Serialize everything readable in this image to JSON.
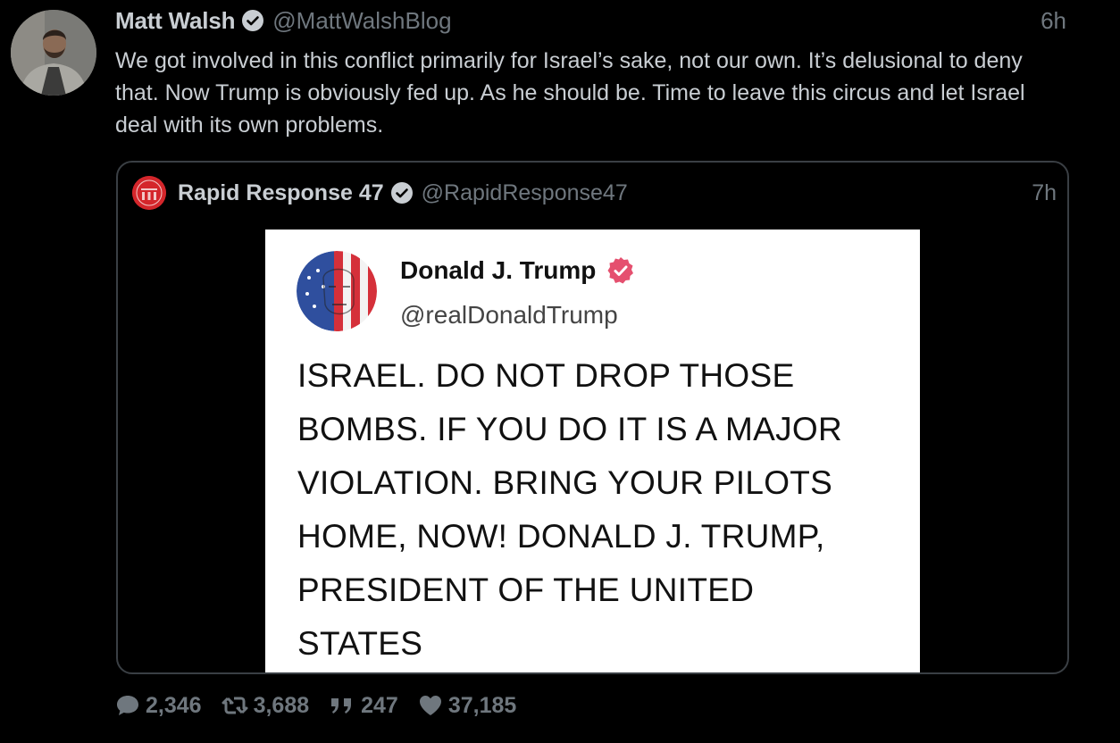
{
  "author": {
    "display_name": "Matt Walsh",
    "handle": "@MattWalshBlog",
    "timestamp": "6h",
    "avatar_icon": "profile-photo-man-beard"
  },
  "tweet": {
    "text": "We got involved in this conflict primarily for Israel’s sake, not our own. It’s delusional to deny that. Now Trump is obviously fed up. As he should be. Time to leave this circus and let Israel deal with its own problems."
  },
  "quote": {
    "display_name": "Rapid Response 47",
    "handle": "@RapidResponse47",
    "timestamp": "7h",
    "avatar_icon": "rapid-response-seal",
    "embed": {
      "name": "Donald J. Trump",
      "handle": "@realDonaldTrump",
      "avatar_icon": "flag-face-portrait",
      "badge_color": "#e5506f",
      "body": "ISRAEL. DO NOT DROP THOSE\nBOMBS. IF YOU DO IT IS A MAJOR\nVIOLATION. BRING YOUR PILOTS\nHOME, NOW!  DONALD J. TRUMP,\nPRESIDENT OF THE UNITED\nSTATES"
    }
  },
  "stats": {
    "replies": "2,346",
    "retweets": "3,688",
    "quotes": "247",
    "likes": "37,185"
  },
  "colors": {
    "background": "#000000",
    "primary_text": "#c9ced3",
    "secondary_text": "#6f777e",
    "border": "#3a3f44"
  }
}
